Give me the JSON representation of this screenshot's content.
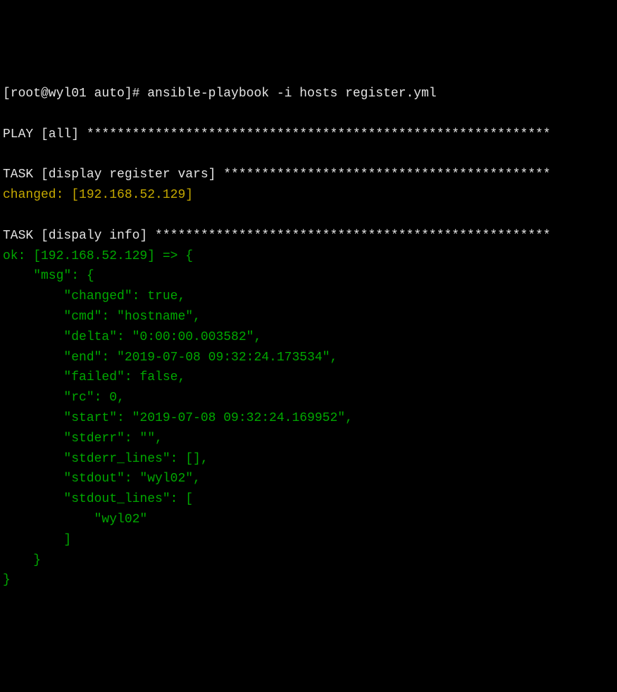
{
  "prompt": {
    "prefix": "[root@wyl01 auto]# ",
    "command": "ansible-playbook -i hosts register.yml"
  },
  "play_header": "PLAY [all] *************************************************************",
  "task1": {
    "header": "TASK [display register vars] *******************************************",
    "status": "changed: [192.168.52.129]"
  },
  "task2": {
    "header": "TASK [dispaly info] ****************************************************",
    "status_line": "ok: [192.168.52.129] => {",
    "msg_open": "    \"msg\": {",
    "changed": "        \"changed\": true,",
    "cmd": "        \"cmd\": \"hostname\",",
    "delta": "        \"delta\": \"0:00:00.003582\",",
    "end": "        \"end\": \"2019-07-08 09:32:24.173534\",",
    "failed": "        \"failed\": false,",
    "rc": "        \"rc\": 0,",
    "start": "        \"start\": \"2019-07-08 09:32:24.169952\",",
    "stderr": "        \"stderr\": \"\",",
    "stderr_lines": "        \"stderr_lines\": [],",
    "stdout": "        \"stdout\": \"wyl02\",",
    "stdout_lines_open": "        \"stdout_lines\": [",
    "stdout_lines_item": "            \"wyl02\"",
    "stdout_lines_close": "        ]",
    "msg_close": "    }",
    "obj_close": "}"
  }
}
